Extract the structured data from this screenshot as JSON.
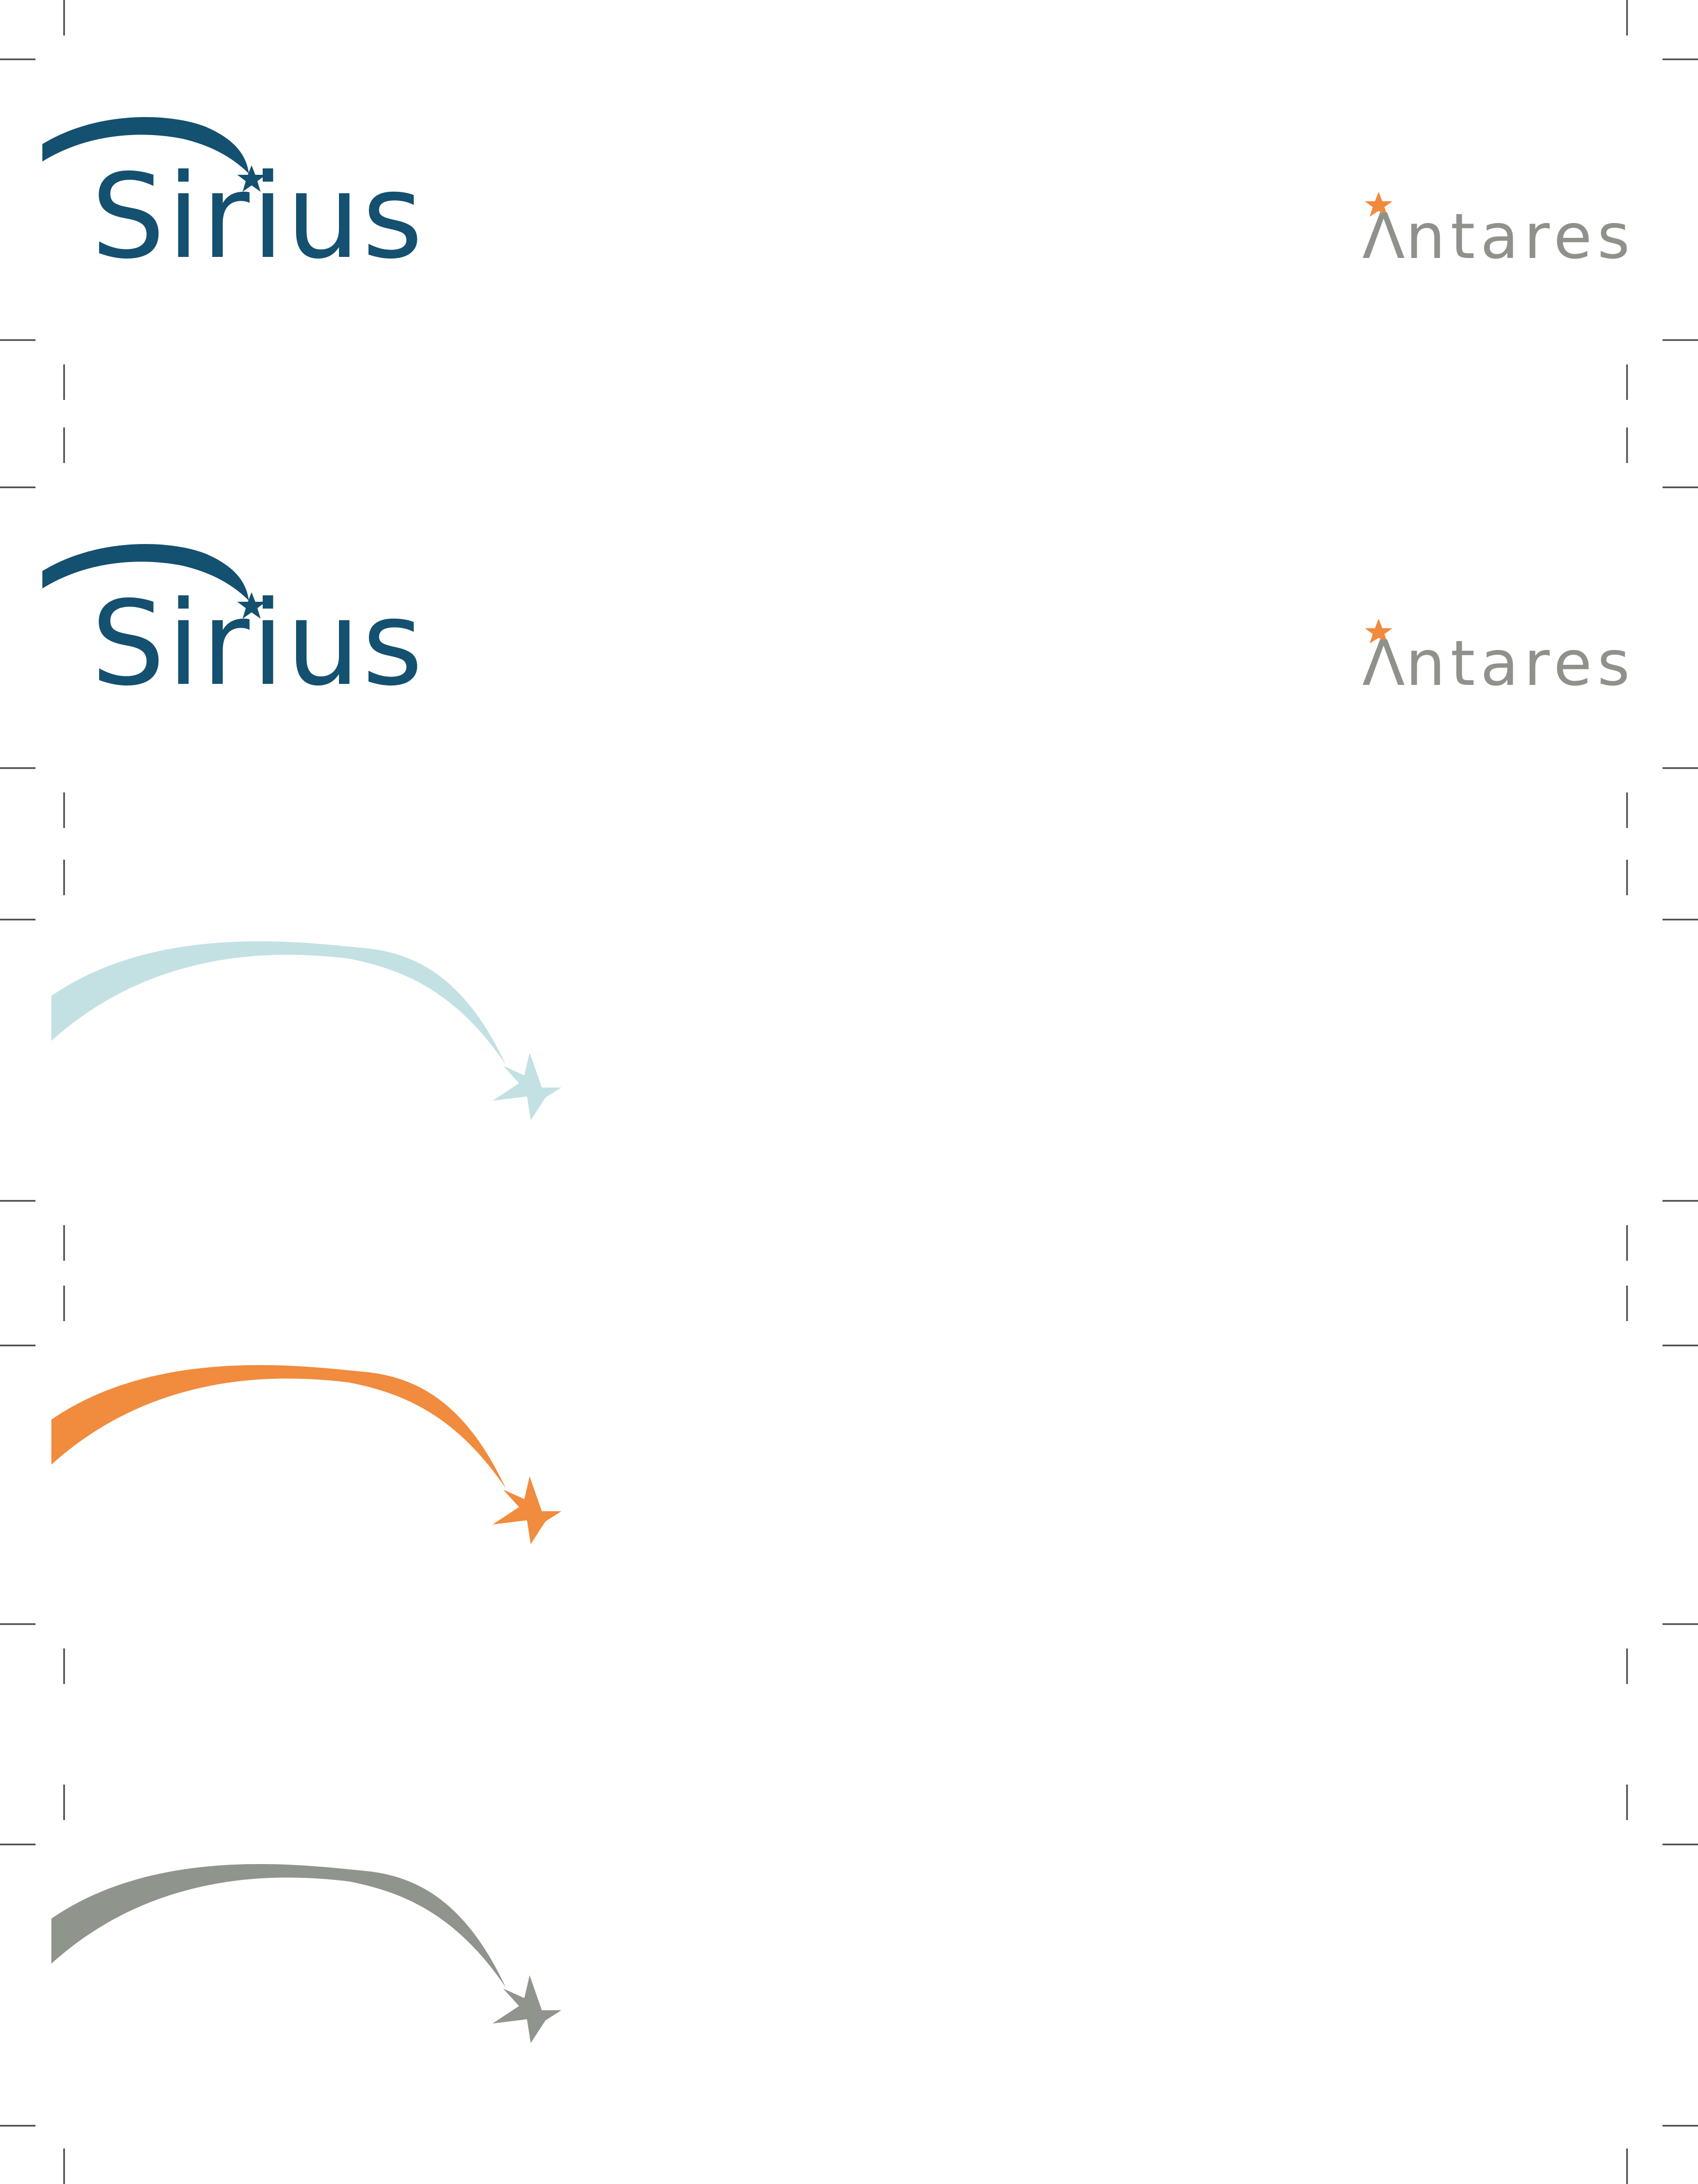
{
  "logos": {
    "primary": {
      "wordmark": "Sirius",
      "color": "#14506f"
    },
    "secondary": {
      "wordmark": "ntares",
      "caret": "Λ",
      "text_color": "#8e928b",
      "star_color": "#f08a3c"
    }
  },
  "swooshes": [
    {
      "name": "light-blue",
      "color": "#c3e1e3"
    },
    {
      "name": "orange",
      "color": "#f18b3d"
    },
    {
      "name": "gray",
      "color": "#8f948c"
    }
  ]
}
